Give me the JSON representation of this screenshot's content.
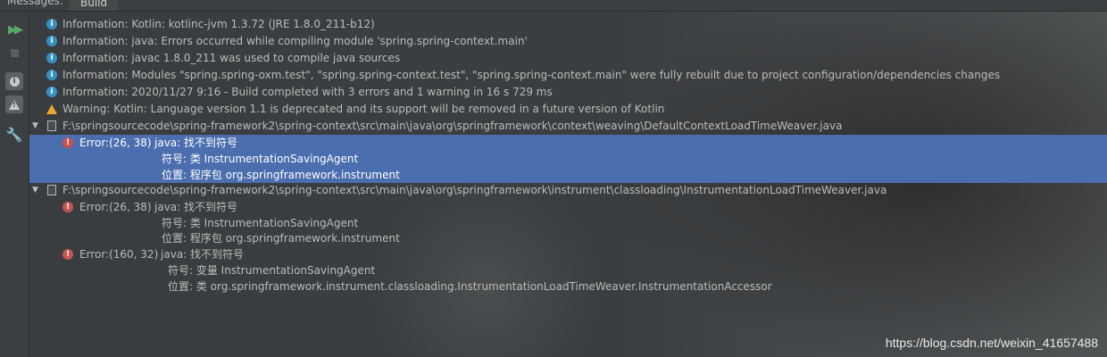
{
  "header": {
    "messages_label": "Messages:",
    "tab_build": "Build"
  },
  "toolbar": {
    "run_icon": "rerun-icon",
    "stop_icon": "stop-icon",
    "info_filter_icon": "info-icon",
    "warning_filter_icon": "warning-icon",
    "settings_icon": "wrench-icon"
  },
  "messages": {
    "info1": "Information: Kotlin: kotlinc-jvm 1.3.72 (JRE 1.8.0_211-b12)",
    "info2": "Information: java: Errors occurred while compiling module 'spring.spring-context.main'",
    "info3": "Information: javac 1.8.0_211 was used to compile java sources",
    "info4": "Information: Modules \"spring.spring-oxm.test\", \"spring.spring-context.test\", \"spring.spring-context.main\" were fully rebuilt due to project configuration/dependencies changes",
    "info5": "Information: 2020/11/27 9:16 - Build completed with 3 errors and 1 warning in 16 s 729 ms",
    "warning1": "Warning: Kotlin: Language version 1.1 is deprecated and its support will be removed in a future version of Kotlin"
  },
  "files": [
    {
      "path": "F:\\springsourcecode\\spring-framework2\\spring-context\\src\\main\\java\\org\\springframework\\context\\weaving\\DefaultContextLoadTimeWeaver.java",
      "errors": [
        {
          "location": "Error:(26, 38)",
          "message": "java: 找不到符号",
          "symbol": "符号:   类 InstrumentationSavingAgent",
          "position": "位置: 程序包 org.springframework.instrument"
        }
      ]
    },
    {
      "path": "F:\\springsourcecode\\spring-framework2\\spring-context\\src\\main\\java\\org\\springframework\\instrument\\classloading\\InstrumentationLoadTimeWeaver.java",
      "errors": [
        {
          "location": "Error:(26, 38)",
          "message": "java: 找不到符号",
          "symbol": "符号:   类 InstrumentationSavingAgent",
          "position": "位置: 程序包 org.springframework.instrument"
        },
        {
          "location": "Error:(160, 32)",
          "message": "java: 找不到符号",
          "symbol": "符号:   变量 InstrumentationSavingAgent",
          "position": "位置: 类 org.springframework.instrument.classloading.InstrumentationLoadTimeWeaver.InstrumentationAccessor"
        }
      ]
    }
  ],
  "watermark": "https://blog.csdn.net/weixin_41657488",
  "colors": {
    "selection": "#4b6eaf",
    "info": "#3592c4",
    "warning": "#f0a732",
    "error": "#c75450"
  }
}
